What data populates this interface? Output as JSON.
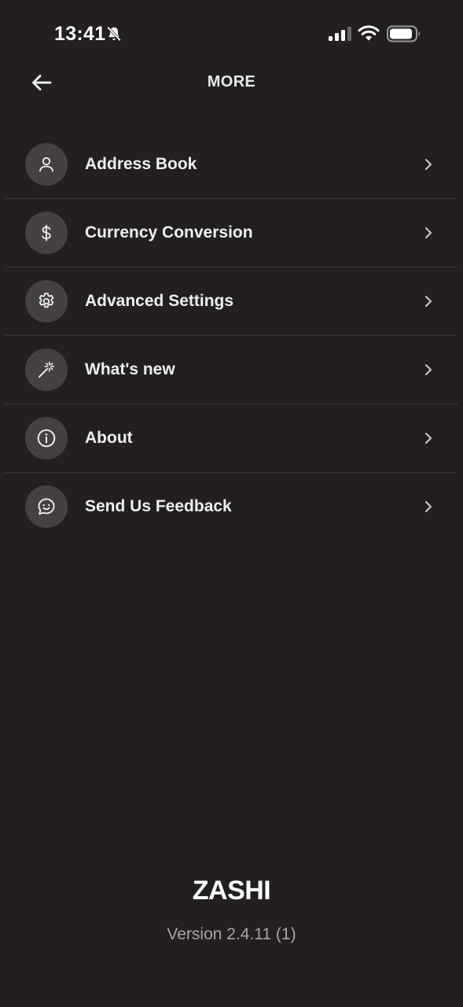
{
  "status_bar": {
    "time": "13:41",
    "icons": [
      "bell-off-icon",
      "signal-icon",
      "wifi-icon",
      "battery-icon"
    ]
  },
  "header": {
    "title": "MORE",
    "back_icon": "arrow-left-icon"
  },
  "menu": {
    "items": [
      {
        "label": "Address Book",
        "icon": "person-icon"
      },
      {
        "label": "Currency Conversion",
        "icon": "dollar-icon"
      },
      {
        "label": "Advanced Settings",
        "icon": "gear-icon"
      },
      {
        "label": "What's new",
        "icon": "magic-wand-icon"
      },
      {
        "label": "About",
        "icon": "info-icon"
      },
      {
        "label": "Send Us Feedback",
        "icon": "chat-smile-icon"
      }
    ]
  },
  "footer": {
    "brand": "ZASHI",
    "version": "Version 2.4.11 (1)"
  },
  "colors": {
    "background": "#231f20",
    "icon_circle": "#454142",
    "divider": "#3a3637",
    "text_primary": "#efefef",
    "text_secondary": "#a7a5a6"
  }
}
